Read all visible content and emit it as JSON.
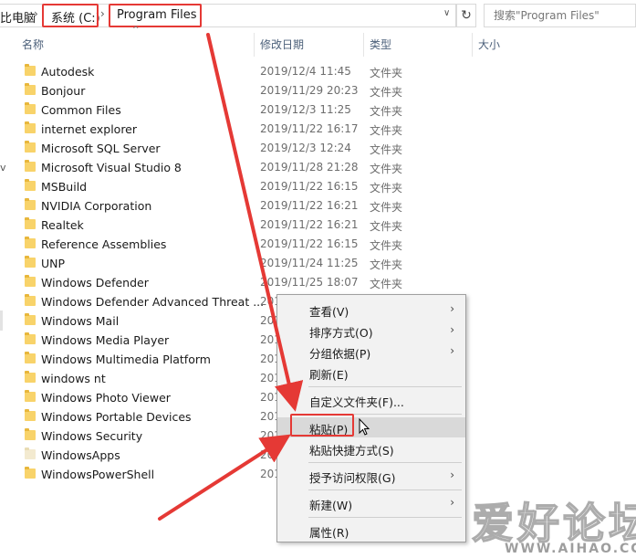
{
  "address_bar": {
    "crumbs": [
      "比电脑",
      "系统 (C:)",
      "Program Files"
    ],
    "search_placeholder": "搜索\"Program Files\""
  },
  "columns": {
    "name": "名称",
    "modified": "修改日期",
    "type": "类型",
    "size": "大小"
  },
  "files": [
    {
      "name": "Autodesk",
      "date": "2019/12/4 11:45",
      "type": "文件夹"
    },
    {
      "name": "Bonjour",
      "date": "2019/11/29 20:23",
      "type": "文件夹"
    },
    {
      "name": "Common Files",
      "date": "2019/12/3 11:25",
      "type": "文件夹"
    },
    {
      "name": "internet explorer",
      "date": "2019/11/22 16:17",
      "type": "文件夹"
    },
    {
      "name": "Microsoft SQL Server",
      "date": "2019/12/3 12:24",
      "type": "文件夹"
    },
    {
      "name": "Microsoft Visual Studio 8",
      "date": "2019/11/28 21:28",
      "type": "文件夹"
    },
    {
      "name": "MSBuild",
      "date": "2019/11/22 16:15",
      "type": "文件夹"
    },
    {
      "name": "NVIDIA Corporation",
      "date": "2019/11/22 16:21",
      "type": "文件夹"
    },
    {
      "name": "Realtek",
      "date": "2019/11/22 16:21",
      "type": "文件夹"
    },
    {
      "name": "Reference Assemblies",
      "date": "2019/11/22 16:15",
      "type": "文件夹"
    },
    {
      "name": "UNP",
      "date": "2019/11/24 11:25",
      "type": "文件夹"
    },
    {
      "name": "Windows Defender",
      "date": "2019/11/25 18:07",
      "type": "文件夹"
    },
    {
      "name": "Windows Defender Advanced Threat ...",
      "date": "201",
      "type": ""
    },
    {
      "name": "Windows Mail",
      "date": "201",
      "type": ""
    },
    {
      "name": "Windows Media Player",
      "date": "201",
      "type": ""
    },
    {
      "name": "Windows Multimedia Platform",
      "date": "201",
      "type": ""
    },
    {
      "name": "windows nt",
      "date": "201",
      "type": ""
    },
    {
      "name": "Windows Photo Viewer",
      "date": "201",
      "type": ""
    },
    {
      "name": "Windows Portable Devices",
      "date": "201",
      "type": ""
    },
    {
      "name": "Windows Security",
      "date": "201",
      "type": ""
    },
    {
      "name": "WindowsApps",
      "date": "201",
      "type": "",
      "muted": true
    },
    {
      "name": "WindowsPowerShell",
      "date": "201",
      "type": ""
    }
  ],
  "context_menu": {
    "view": "查看(V)",
    "sort": "排序方式(O)",
    "group": "分组依据(P)",
    "refresh": "刷新(E)",
    "customize": "自定义文件夹(F)...",
    "paste": "粘贴(P)",
    "paste_shortcut": "粘贴快捷方式(S)",
    "grant_access": "授予访问权限(G)",
    "new": "新建(W)",
    "properties": "属性(R)"
  },
  "watermark": {
    "cn": "爱好论坛",
    "en": "WWW.AIHAO.CC"
  },
  "colors": {
    "highlight_red": "#e53935",
    "folder_yellow": "#f8d36a",
    "menu_bg": "#f2f2f2"
  }
}
